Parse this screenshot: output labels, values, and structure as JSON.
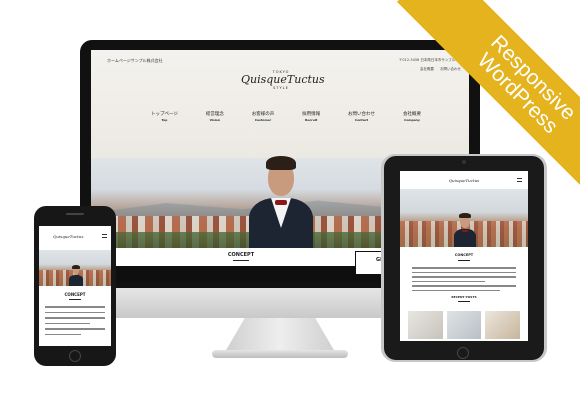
{
  "desktop_site": {
    "company": "ホームページサンプル株式会社",
    "address": "〒012-3456 日本県日本市サンプル1-2",
    "header_links": [
      "会社概要",
      "お問い合わせ"
    ],
    "logo_top": "TOKYO",
    "logo_main": "QuisqueTuctus",
    "logo_sub": "STYLE",
    "nav": [
      {
        "jp": "トップページ",
        "en": "Top"
      },
      {
        "jp": "経営理念",
        "en": "Vision"
      },
      {
        "jp": "お客様の声",
        "en": "Customer"
      },
      {
        "jp": "採用情報",
        "en": "Recruit"
      },
      {
        "jp": "お問い合わせ",
        "en": "Contact"
      },
      {
        "jp": "会社概要",
        "en": "Company"
      }
    ],
    "concept_title": "CONCEPT",
    "group_button": "GRO"
  },
  "tablet_site": {
    "logo": "QuisqueTuctus",
    "concept_title": "CONCEPT",
    "recent_posts": "RECENT POSTS"
  },
  "phone_site": {
    "logo": "QuisqueTuctus",
    "concept_title": "CONCEPT"
  },
  "ribbon": {
    "line1": "Responsive",
    "line2": "WordPress",
    "color": "#e4b31d"
  }
}
